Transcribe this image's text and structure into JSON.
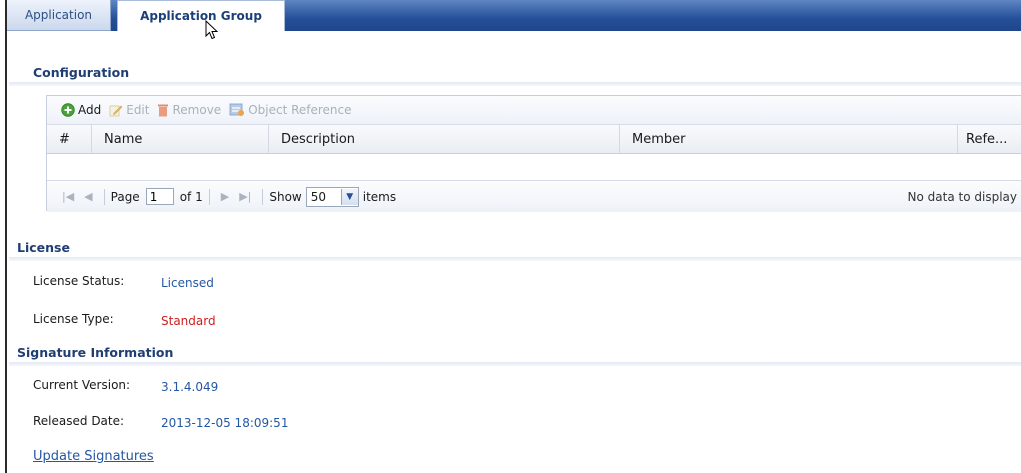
{
  "tabs": [
    {
      "label": "Application",
      "active": false
    },
    {
      "label": "Application Group",
      "active": true
    }
  ],
  "configuration": {
    "title": "Configuration",
    "toolbar": {
      "add_label": "Add",
      "edit_label": "Edit",
      "remove_label": "Remove",
      "object_reference_label": "Object Reference"
    },
    "columns": [
      "#",
      "Name",
      "Description",
      "Member",
      "Refe..."
    ],
    "rows": [],
    "pager": {
      "page_label": "Page",
      "page_value": "1",
      "of_label": "of 1",
      "show_label": "Show",
      "show_value": "50",
      "items_label": "items",
      "no_data_text": "No data to display"
    }
  },
  "license": {
    "title": "License",
    "status_label": "License Status:",
    "status_value": "Licensed",
    "type_label": "License Type:",
    "type_value": "Standard"
  },
  "signature": {
    "title": "Signature Information",
    "version_label": "Current Version:",
    "version_value": "3.1.4.049",
    "date_label": "Released Date:",
    "date_value": "2013-12-05 18:09:51",
    "update_link": "Update Signatures"
  },
  "colors": {
    "tab_bar": "#244f98",
    "section_title": "#1f3f73",
    "value_blue": "#2457a3",
    "value_red": "#cc1f1f"
  }
}
